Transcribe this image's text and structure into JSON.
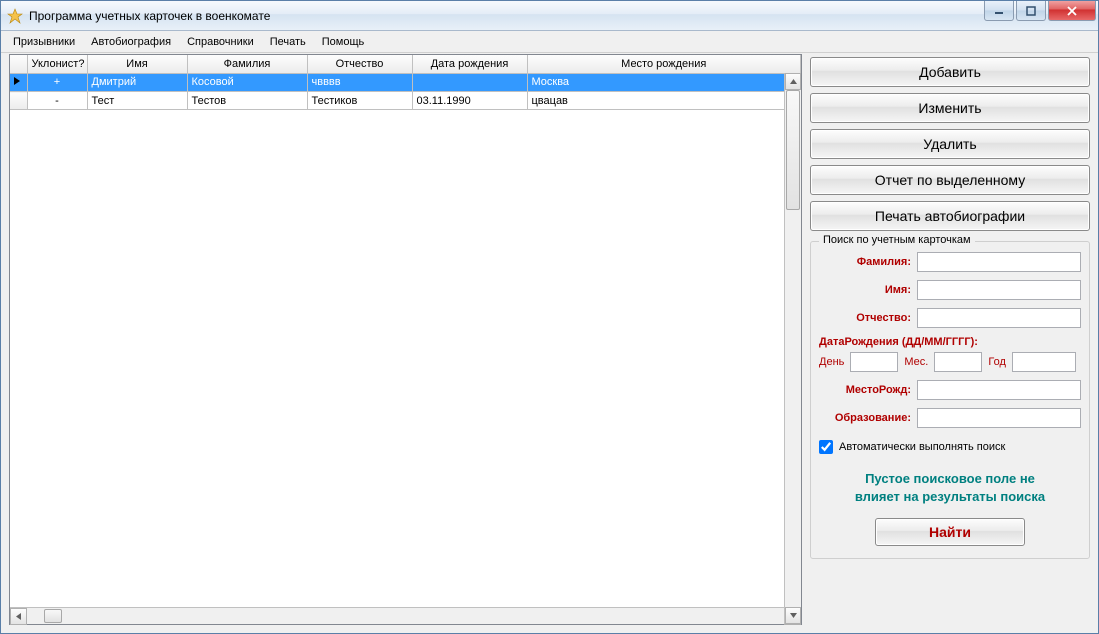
{
  "window": {
    "title": "Программа учетных карточек в военкомате"
  },
  "menu": {
    "items": [
      "Призывники",
      "Автобиография",
      "Справочники",
      "Печать",
      "Помощь"
    ]
  },
  "grid": {
    "columns": [
      "Уклонист?",
      "Имя",
      "Фамилия",
      "Отчество",
      "Дата рождения",
      "Место рождения"
    ],
    "rows": [
      {
        "selected": true,
        "uklonist": "+",
        "name": "Дмитрий",
        "surname": "Косовой",
        "patronymic": "чвввв",
        "dob": "",
        "place": "Москва"
      },
      {
        "selected": false,
        "uklonist": "-",
        "name": "Тест",
        "surname": "Тестов",
        "patronymic": "Тестиков",
        "dob": "03.11.1990",
        "place": "цвацав"
      }
    ]
  },
  "buttons": {
    "add": "Добавить",
    "edit": "Изменить",
    "del": "Удалить",
    "report": "Отчет по выделенному",
    "printbio": "Печать автобиографии",
    "find": "Найти"
  },
  "search": {
    "legend": "Поиск по учетным карточкам",
    "labels": {
      "surname": "Фамилия:",
      "name": "Имя:",
      "patronymic": "Отчество:",
      "dob": "ДатаРождения (ДД/ММ/ГГГГ):",
      "day": "День",
      "month": "Мес.",
      "year": "Год",
      "place": "МестоРожд:",
      "education": "Образование:"
    },
    "autorun": "Автоматически выполнять поиск",
    "info1": "Пустое поисковое поле не",
    "info2": "влияет на результаты поиска"
  }
}
